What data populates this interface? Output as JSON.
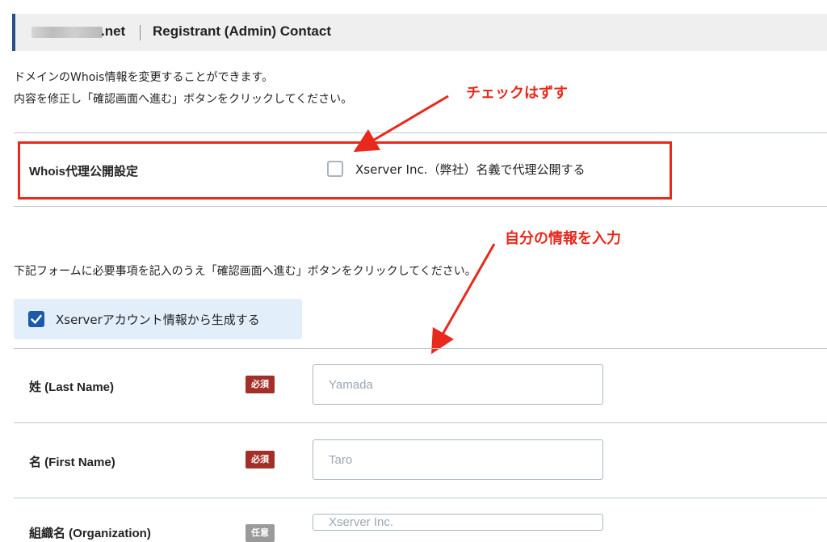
{
  "header": {
    "domain_tld": ".net",
    "title": "Registrant (Admin) Contact"
  },
  "intro": {
    "line1": "ドメインのWhois情報を変更することができます。",
    "line2": "内容を修正し「確認画面へ進む」ボタンをクリックしてください。"
  },
  "proxy": {
    "label": "Whois代理公開設定",
    "checkbox_label": "Xserver Inc.（弊社）名義で代理公開する",
    "checked": false
  },
  "annotations": {
    "uncheck": "チェックはずす",
    "input_info": "自分の情報を入力"
  },
  "form_instruction": "下記フォームに必要事項を記入のうえ「確認画面へ進む」ボタンをクリックしてください。",
  "generate": {
    "label": "Xserverアカウント情報から生成する",
    "checked": true
  },
  "fields": [
    {
      "label": "姓 (Last Name)",
      "badge": "必須",
      "placeholder": "Yamada"
    },
    {
      "label": "名 (First Name)",
      "badge": "必須",
      "placeholder": "Taro"
    },
    {
      "label": "組織名 (Organization)",
      "badge": "任意",
      "placeholder": "Xserver Inc."
    }
  ],
  "colors": {
    "accent_blue": "#1a5aa8",
    "annotation_red": "#e8291c",
    "required_badge": "#a23028"
  }
}
